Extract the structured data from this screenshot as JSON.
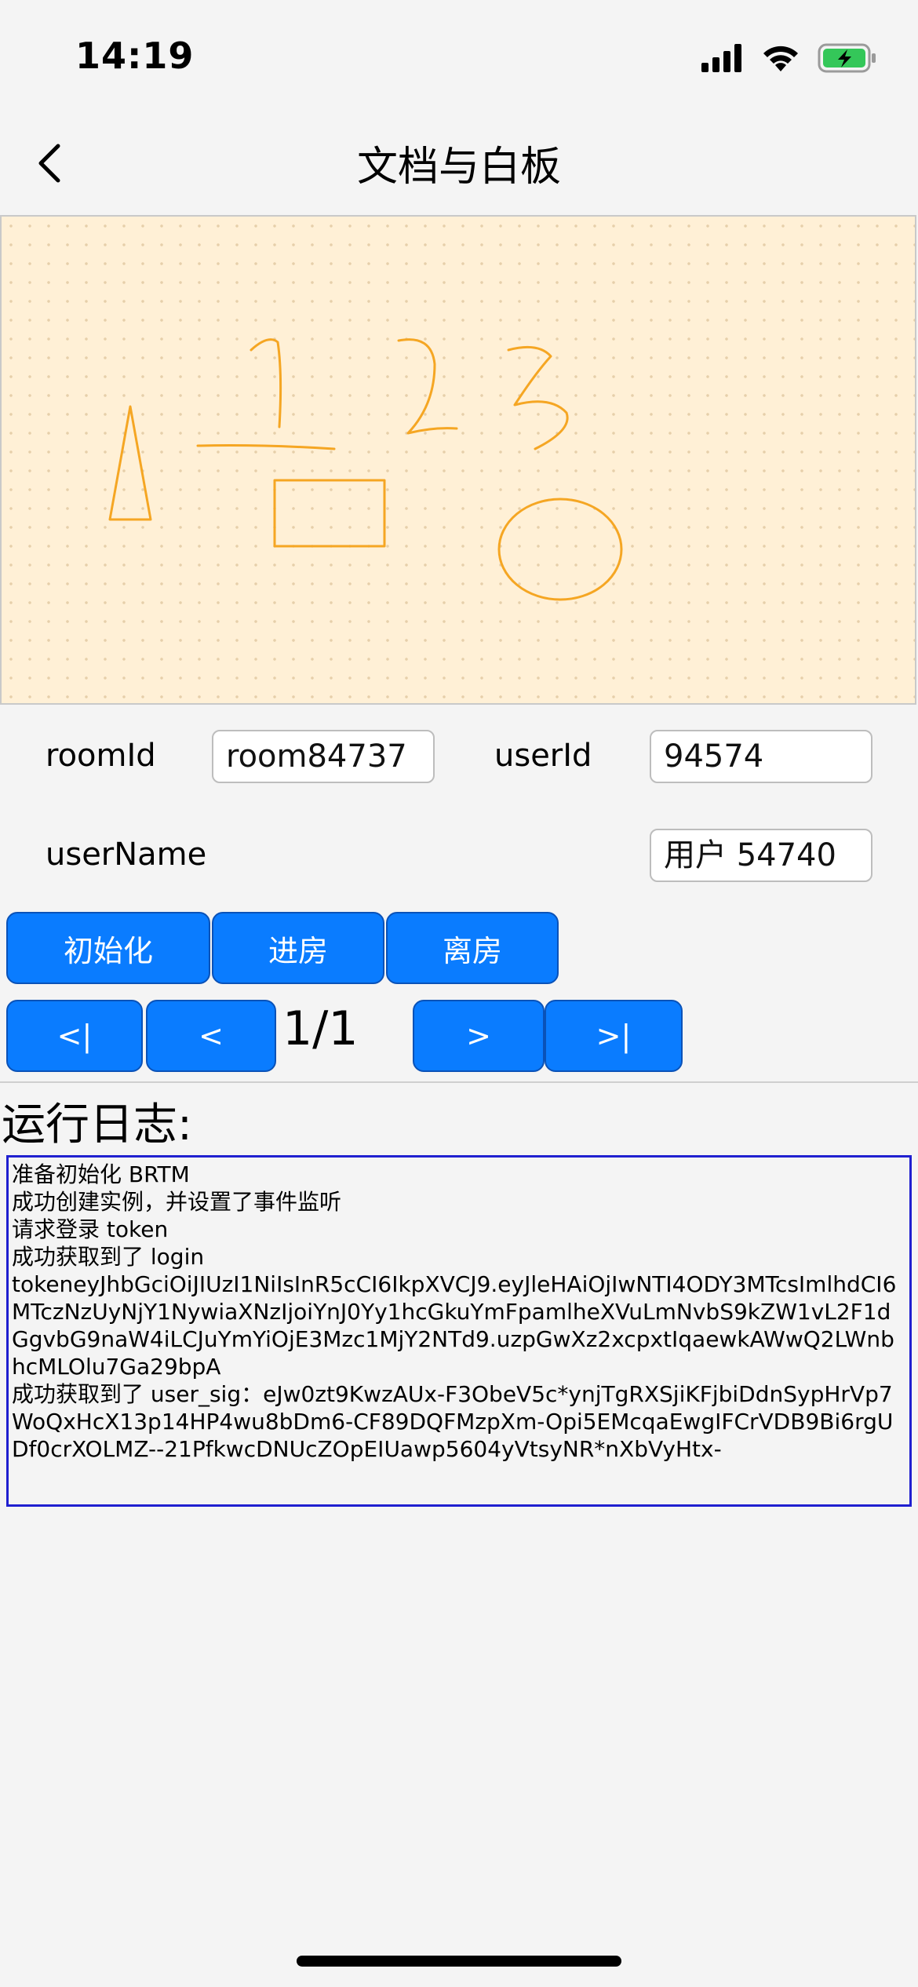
{
  "status_bar": {
    "time": "14:19"
  },
  "nav": {
    "title": "文档与白板",
    "back_icon": "chevron-left-icon"
  },
  "form": {
    "room_label": "roomId",
    "room_value": "room84737",
    "user_label": "userId",
    "user_value": "94574",
    "username_label": "userName",
    "username_value": "用户 54740"
  },
  "actions": {
    "init": "初始化",
    "join": "进房",
    "leave": "离房"
  },
  "paging": {
    "first": "<|",
    "prev": "<",
    "page": "1/1",
    "next": ">",
    "last": ">|"
  },
  "log": {
    "title": "运行日志:",
    "lines": [
      "准备初始化 BRTM",
      "成功创建实例，并设置了事件监听",
      "请求登录 token",
      "成功获取到了 login",
      "tokeneyJhbGciOiJIUzI1NiIsInR5cCI6IkpXVCJ9.eyJleHAiOjIwNTI4ODY3MTcsImlhdCI6MTczNzUyNjY1NywiaXNzIjoiYnJ0Yy1hcGkuYmFpamlheXVuLmNvbS9kZW1vL2F1dGgvbG9naW4iLCJuYmYiOjE3Mzc1MjY2NTd9.uzpGwXz2xcpxtIqaewkAWwQ2LWnbhcMLOlu7Ga29bpA",
      "成功获取到了 user_sig：eJw0zt9KwzAUx-F3ObeV5c*ynjTgRXSjiKFjbiDdnSypHrVp7WoQxHcX13p14HP4wu8bDm6-CF89DQFMzpXm-Opi5EMcqaEwgIFCrVDB9Bi6rgUDf0crXOLMZ--21PfkwcDNUcZOpEIUawp5604yVtsyNR*nXbVyHtx-"
    ]
  },
  "colors": {
    "button": "#0a7cff",
    "board_bg": "#fff0d6",
    "ink": "#f5a623",
    "log_border": "#2020d0"
  }
}
